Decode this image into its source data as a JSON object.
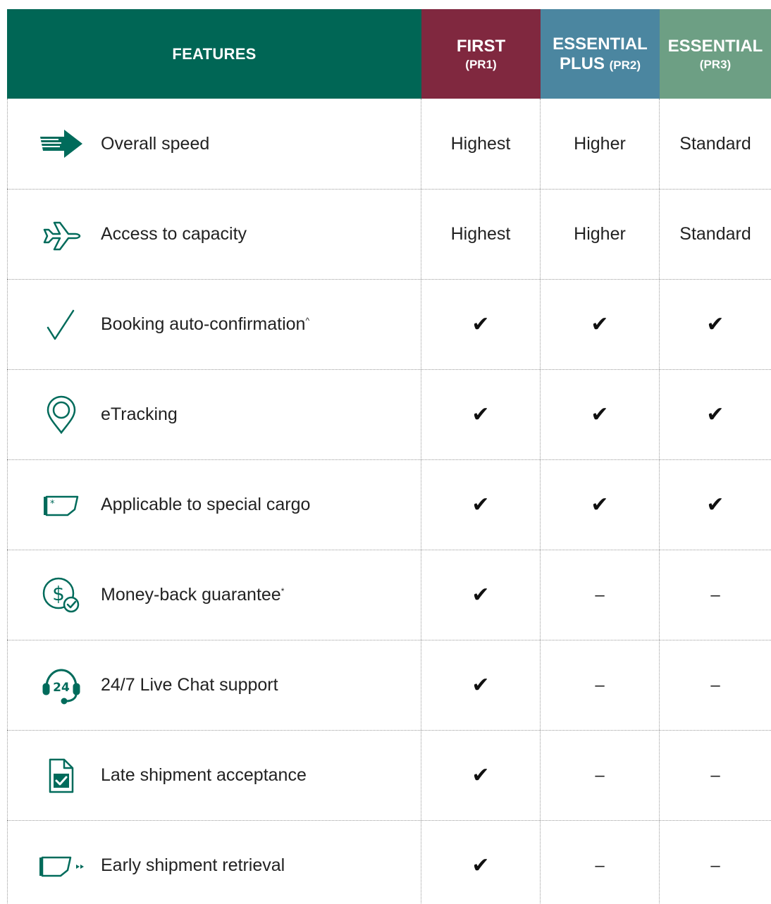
{
  "header": {
    "features": "FEATURES",
    "first_main": "FIRST",
    "first_sub": "(PR1)",
    "plus_main1": "ESSENTIAL",
    "plus_main2": "PLUS",
    "plus_sub": "(PR2)",
    "ess_main": "ESSENTIAL",
    "ess_sub": "(PR3)"
  },
  "colors": {
    "features": "#006655",
    "first": "#80283f",
    "essential_plus": "#4b86a0",
    "essential": "#6d9f84",
    "icon": "#006b5b"
  },
  "rows": [
    {
      "icon": "speed-arrow-icon",
      "label": "Overall speed",
      "mark": "",
      "first": "Highest",
      "plus": "Higher",
      "ess": "Standard"
    },
    {
      "icon": "airplane-icon",
      "label": "Access to capacity",
      "mark": "",
      "first": "Highest",
      "plus": "Higher",
      "ess": "Standard"
    },
    {
      "icon": "checkmark-icon",
      "label": "Booking auto-confirmation",
      "mark": "^",
      "first": "✔",
      "plus": "✔",
      "ess": "✔"
    },
    {
      "icon": "location-pin-icon",
      "label": "eTracking",
      "mark": "",
      "first": "✔",
      "plus": "✔",
      "ess": "✔"
    },
    {
      "icon": "special-cargo-tag-icon",
      "label": "Applicable to special cargo",
      "mark": "",
      "first": "✔",
      "plus": "✔",
      "ess": "✔"
    },
    {
      "icon": "money-back-icon",
      "label": "Money-back guarantee",
      "mark": "*",
      "first": "✔",
      "plus": "–",
      "ess": "–"
    },
    {
      "icon": "live-chat-24-icon",
      "label": "24/7 Live Chat support",
      "mark": "",
      "first": "✔",
      "plus": "–",
      "ess": "–"
    },
    {
      "icon": "document-check-icon",
      "label": "Late shipment acceptance",
      "mark": "",
      "first": "✔",
      "plus": "–",
      "ess": "–"
    },
    {
      "icon": "early-retrieval-tag-icon",
      "label": "Early shipment retrieval",
      "mark": "",
      "first": "✔",
      "plus": "–",
      "ess": "–"
    }
  ]
}
